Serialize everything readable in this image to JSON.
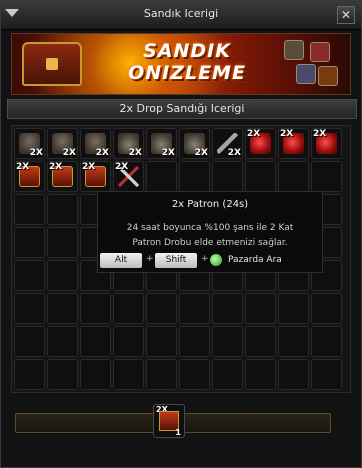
{
  "window": {
    "title": "Sandık Icerigi",
    "close_glyph": "✕"
  },
  "banner": {
    "title_line1": "SANDIK",
    "title_line2": "ONIZLEME"
  },
  "section": {
    "title": "2x Drop Sandığı Icerigi"
  },
  "grid": {
    "columns": 10,
    "total_slots": 80,
    "items": [
      {
        "icon": "armor-icon",
        "art": "armor",
        "qty": "2X",
        "qty_pos": "bottom"
      },
      {
        "icon": "armor-icon",
        "art": "armor",
        "qty": "2X",
        "qty_pos": "bottom"
      },
      {
        "icon": "armor-icon",
        "art": "armor",
        "qty": "2X",
        "qty_pos": "bottom"
      },
      {
        "icon": "helmet-icon",
        "art": "helmet",
        "qty": "2X",
        "qty_pos": "bottom"
      },
      {
        "icon": "helmet-icon",
        "art": "helmet",
        "qty": "2X",
        "qty_pos": "bottom"
      },
      {
        "icon": "helmet-icon",
        "art": "helmet",
        "qty": "2X",
        "qty_pos": "bottom"
      },
      {
        "icon": "sword-icon",
        "art": "sword",
        "qty": "2X",
        "qty_pos": "bottom"
      },
      {
        "icon": "red-gem-icon",
        "art": "gem",
        "qty": "2X",
        "qty_pos": "top"
      },
      {
        "icon": "red-gem-icon",
        "art": "gem",
        "qty": "2X",
        "qty_pos": "top"
      },
      {
        "icon": "red-gem-icon",
        "art": "gem",
        "qty": "2X",
        "qty_pos": "top"
      },
      {
        "icon": "red-chest-icon",
        "art": "chest",
        "qty": "2X",
        "qty_pos": "top"
      },
      {
        "icon": "red-chest-icon",
        "art": "chest",
        "qty": "2X",
        "qty_pos": "top"
      },
      {
        "icon": "red-chest-icon",
        "art": "chest",
        "qty": "2X",
        "qty_pos": "top"
      },
      {
        "icon": "crossed-swords-icon",
        "art": "cross",
        "qty": "2X",
        "qty_pos": "top"
      }
    ]
  },
  "tooltip": {
    "title": "2x Patron (24s)",
    "desc_line1": "24 saat boyunca %100 şans ile 2 Kat",
    "desc_line2": "Patron Drobu elde etmenizi sağlar.",
    "key1": "Alt",
    "plus": "+",
    "key2": "Shift",
    "market_icon": "market-icon",
    "market_label": "Pazarda Ara"
  },
  "bottom": {
    "item_icon": "red-chest-icon",
    "item_qty_top": "2X",
    "item_qty": "1"
  }
}
